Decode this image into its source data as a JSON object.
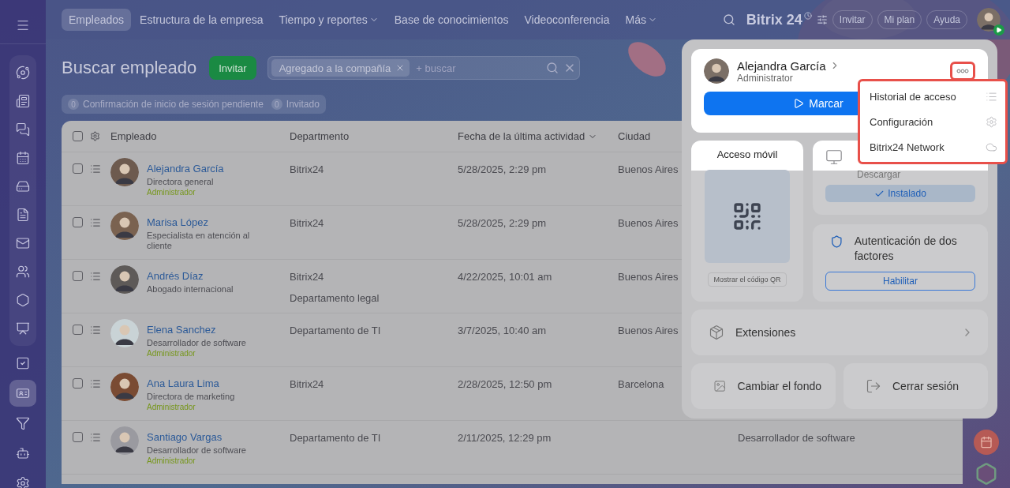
{
  "sidebar": {
    "items": [
      {
        "selected": false
      },
      {
        "selected": false
      },
      {
        "selected": false
      },
      {
        "selected": false
      },
      {
        "selected": false
      },
      {
        "selected": false
      },
      {
        "selected": false
      },
      {
        "selected": false
      },
      {
        "selected": false
      },
      {
        "selected": false
      },
      {
        "selected": false
      },
      {
        "selected": true
      },
      {
        "selected": false
      },
      {
        "selected": false
      },
      {
        "selected": false
      }
    ]
  },
  "top_nav": {
    "tabs": [
      {
        "label": "Empleados",
        "selected": true,
        "dropdown": false
      },
      {
        "label": "Estructura de la empresa",
        "selected": false,
        "dropdown": false
      },
      {
        "label": "Tiempo y reportes",
        "selected": false,
        "dropdown": true
      },
      {
        "label": "Base de conocimientos",
        "selected": false,
        "dropdown": false
      },
      {
        "label": "Videoconferencia",
        "selected": false,
        "dropdown": false
      },
      {
        "label": "Más",
        "selected": false,
        "dropdown": true
      }
    ],
    "logo": "Bitrix 24",
    "buttons": [
      "Invitar",
      "Mi plan",
      "Ayuda"
    ]
  },
  "page": {
    "title": "Buscar empleado",
    "invite_button": "Invitar",
    "search": {
      "chip": "Agregado a la compañía",
      "placeholder": "+ buscar"
    },
    "counters": [
      {
        "count": "0",
        "label": "Confirmación de inicio de sesión pendiente"
      },
      {
        "count": "0",
        "label": "Invitado"
      }
    ]
  },
  "table": {
    "select_all_checked": false,
    "columns": [
      {
        "label": "Empleado",
        "sorted": false
      },
      {
        "label": "Departmento",
        "sorted": false
      },
      {
        "label": "Fecha de la última actividad",
        "sorted": true
      },
      {
        "label": "Ciudad",
        "sorted": false
      }
    ],
    "rows": [
      {
        "checked": false,
        "name": "Alejandra García",
        "title": "Directora general",
        "role": "Administrador",
        "department": [
          "Bitrix24"
        ],
        "last_activity": "5/28/2025, 2:29 pm",
        "city": "Buenos Aires"
      },
      {
        "checked": false,
        "name": "Marisa López",
        "title": "Especialista en atención al cliente",
        "department": [
          "Bitrix24"
        ],
        "last_activity": "5/28/2025, 2:29 pm",
        "city": "Buenos Aires"
      },
      {
        "checked": false,
        "name": "Andrés Díaz",
        "title": "Abogado internacional",
        "department": [
          "Bitrix24",
          "Departamento legal"
        ],
        "last_activity": "4/22/2025, 10:01 am",
        "city": "Buenos Aires"
      },
      {
        "checked": false,
        "name": "Elena Sanchez",
        "title": "Desarrollador de software",
        "role": "Administrador",
        "department": [
          "Departamento de TI"
        ],
        "last_activity": "3/7/2025, 10:40 am",
        "city": "Buenos Aires"
      },
      {
        "checked": false,
        "name": "Ana Laura Lima",
        "title": "Directora de marketing",
        "role": "Administrador",
        "department": [
          "Bitrix24"
        ],
        "last_activity": "2/28/2025, 12:50 pm",
        "city": "Barcelona"
      },
      {
        "checked": false,
        "name": "Santiago Vargas",
        "title": "Desarrollador de software",
        "role": "Administrador",
        "department": [
          "Departamento de TI"
        ],
        "last_activity": "2/11/2025, 12:29 pm",
        "column_5": "Desarrollador de software"
      }
    ]
  },
  "profile_popup": {
    "name": "Alejandra García",
    "role": "Administrator",
    "more_highlighted": true,
    "mark_button": "Marcar",
    "menu": {
      "highlighted": true,
      "items": [
        "Historial de acceso",
        "Configuración",
        "Bitrix24 Network"
      ]
    },
    "mobile_card": {
      "title": "Acceso móvil",
      "button": "Mostrar el código QR"
    },
    "desktop_card": {
      "subtitle": "Descargar",
      "status_button": "Instalado"
    },
    "two_factor_card": {
      "title": "Autenticación de dos factores",
      "button": "Habilitar"
    },
    "extensions": "Extensiones",
    "actions": [
      "Cambiar el fondo",
      "Cerrar sesión"
    ]
  }
}
